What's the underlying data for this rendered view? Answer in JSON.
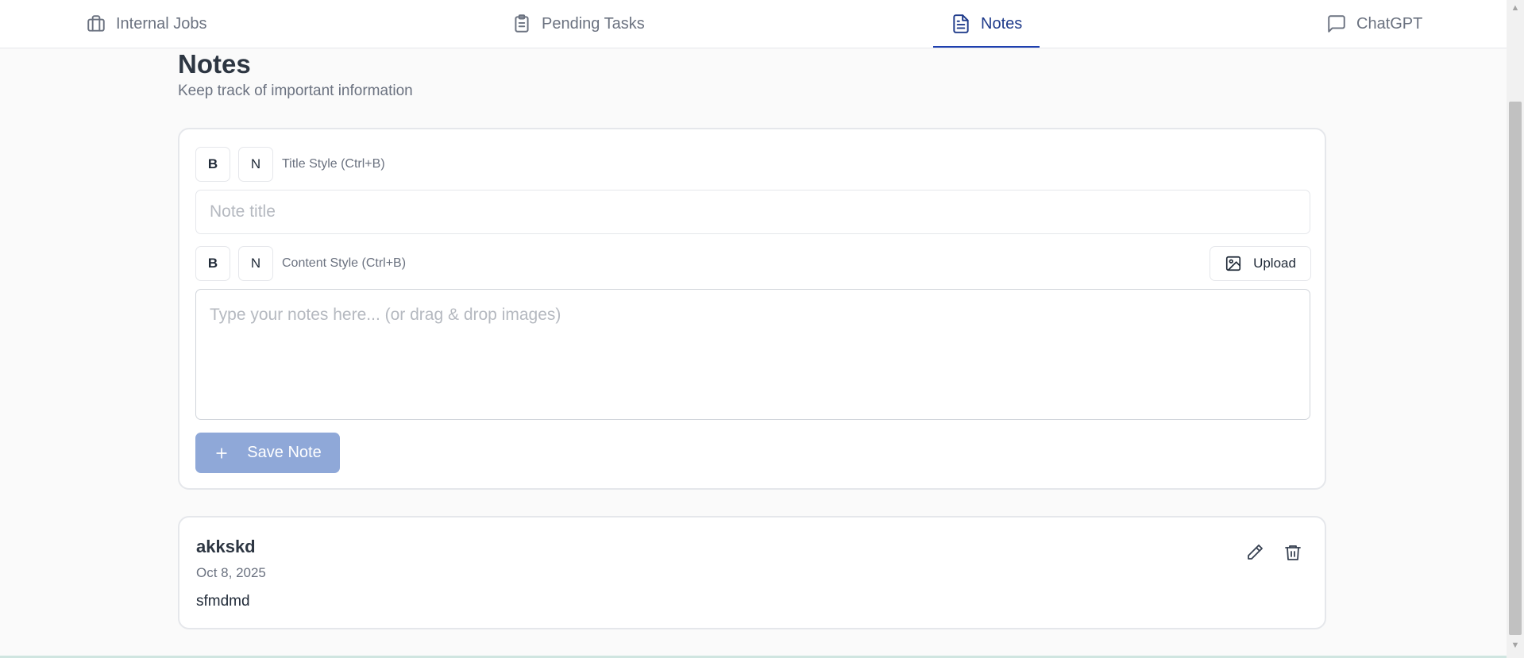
{
  "nav": {
    "tabs": [
      {
        "label": "Internal Jobs",
        "icon": "briefcase-icon"
      },
      {
        "label": "Pending Tasks",
        "icon": "clipboard-list-icon"
      },
      {
        "label": "Notes",
        "icon": "file-text-icon",
        "active": true
      },
      {
        "label": "ChatGPT",
        "icon": "message-square-icon"
      }
    ]
  },
  "header": {
    "title": "Notes",
    "subtitle": "Keep track of important information"
  },
  "editor": {
    "title_bold_label": "B",
    "title_normal_label": "N",
    "title_style_hint": "Title Style (Ctrl+B)",
    "title_placeholder": "Note title",
    "content_bold_label": "B",
    "content_normal_label": "N",
    "content_style_hint": "Content Style (Ctrl+B)",
    "upload_label": "Upload",
    "content_placeholder": "Type your notes here... (or drag & drop images)",
    "save_label": "Save Note"
  },
  "notes": [
    {
      "title": "akkskd",
      "date": "Oct 8, 2025",
      "content": "sfmdmd"
    }
  ],
  "colors": {
    "accent": "#1e40af",
    "save_button": "#8fa8d8",
    "background": "#fafafa"
  }
}
